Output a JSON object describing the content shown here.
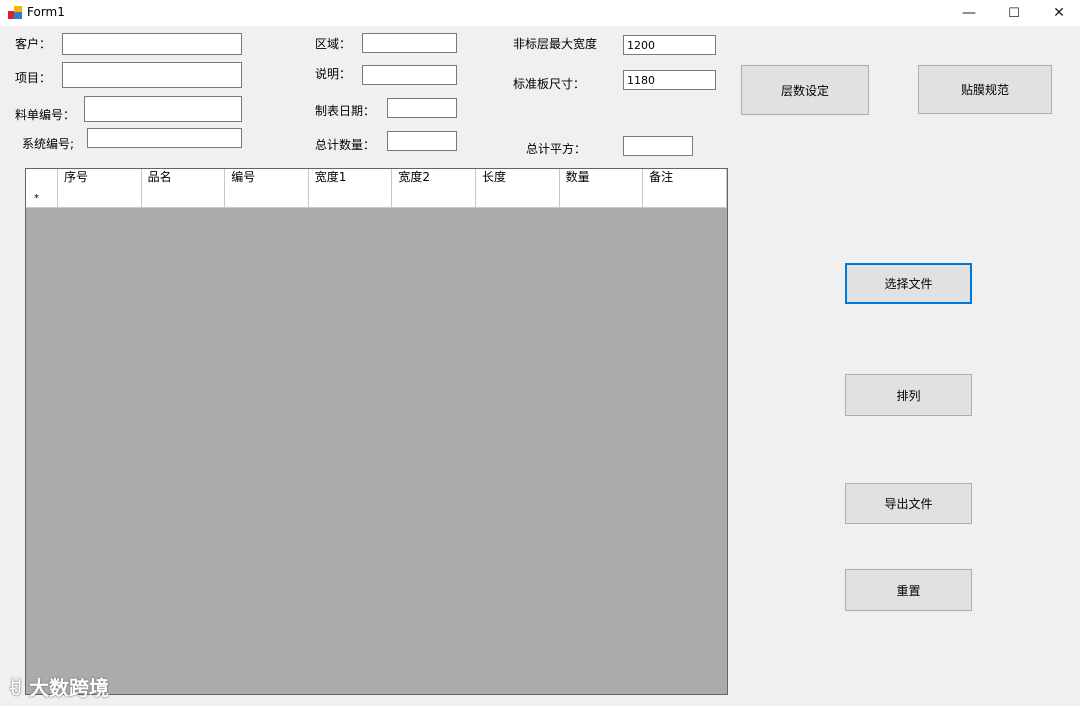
{
  "window": {
    "title": "Form1",
    "minimize": "—",
    "maximize": "☐",
    "close": "✕"
  },
  "labels": {
    "customer": "客户：",
    "project": "项目：",
    "bom_number": "料单编号：",
    "system_number": "系统编号;",
    "area": "区域：",
    "description": "说明：",
    "date": "制表日期：",
    "total_qty": "总计数量：",
    "max_width": "非标层最大宽度",
    "std_size": "标准板尺寸：",
    "total_area": "总计平方："
  },
  "fields": {
    "customer": "",
    "project": "",
    "bom_number": "",
    "system_number": "",
    "area": "",
    "description": "",
    "date": "",
    "total_qty": "",
    "max_width": "1200",
    "std_size": "1180",
    "total_area": ""
  },
  "buttons": {
    "layer_setting": "层数设定",
    "film_spec": "贴膜规范",
    "select_file": "选择文件",
    "arrange": "排列",
    "export_file": "导出文件",
    "reset": "重置"
  },
  "grid": {
    "columns": [
      "序号",
      "品名",
      "编号",
      "宽度1",
      "宽度2",
      "长度",
      "数量",
      "备注"
    ],
    "new_row_marker": "*"
  },
  "watermark": "大数跨境",
  "colors": {
    "focus_border": "#0078d7",
    "grid_background": "#ababab"
  }
}
